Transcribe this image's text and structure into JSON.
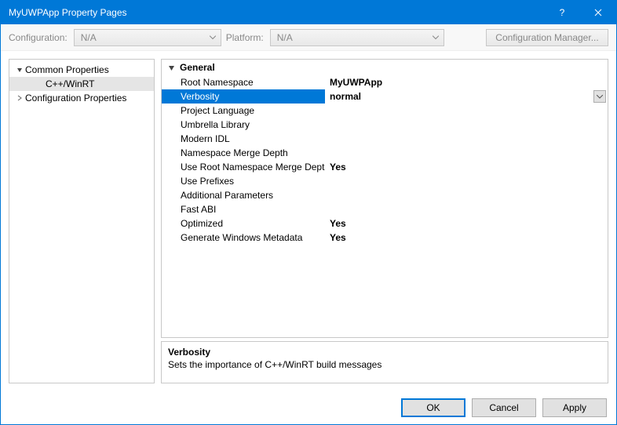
{
  "window": {
    "title": "MyUWPApp Property Pages"
  },
  "toolbar": {
    "configuration_label": "Configuration:",
    "configuration_value": "N/A",
    "platform_label": "Platform:",
    "platform_value": "N/A",
    "config_manager_label": "Configuration Manager..."
  },
  "tree": {
    "root1": "Common Properties",
    "root1_child": "C++/WinRT",
    "root2": "Configuration Properties"
  },
  "grid": {
    "category": "General",
    "rows": [
      {
        "name": "Root Namespace",
        "value": "MyUWPApp"
      },
      {
        "name": "Verbosity",
        "value": "normal"
      },
      {
        "name": "Project Language",
        "value": ""
      },
      {
        "name": "Umbrella Library",
        "value": ""
      },
      {
        "name": "Modern IDL",
        "value": ""
      },
      {
        "name": "Namespace Merge Depth",
        "value": ""
      },
      {
        "name": "Use Root Namespace Merge Dept",
        "value": "Yes"
      },
      {
        "name": "Use Prefixes",
        "value": ""
      },
      {
        "name": "Additional Parameters",
        "value": ""
      },
      {
        "name": "Fast ABI",
        "value": ""
      },
      {
        "name": "Optimized",
        "value": "Yes"
      },
      {
        "name": "Generate Windows Metadata",
        "value": "Yes"
      }
    ]
  },
  "description": {
    "title": "Verbosity",
    "text": "Sets the importance of C++/WinRT build messages"
  },
  "footer": {
    "ok": "OK",
    "cancel": "Cancel",
    "apply": "Apply"
  }
}
